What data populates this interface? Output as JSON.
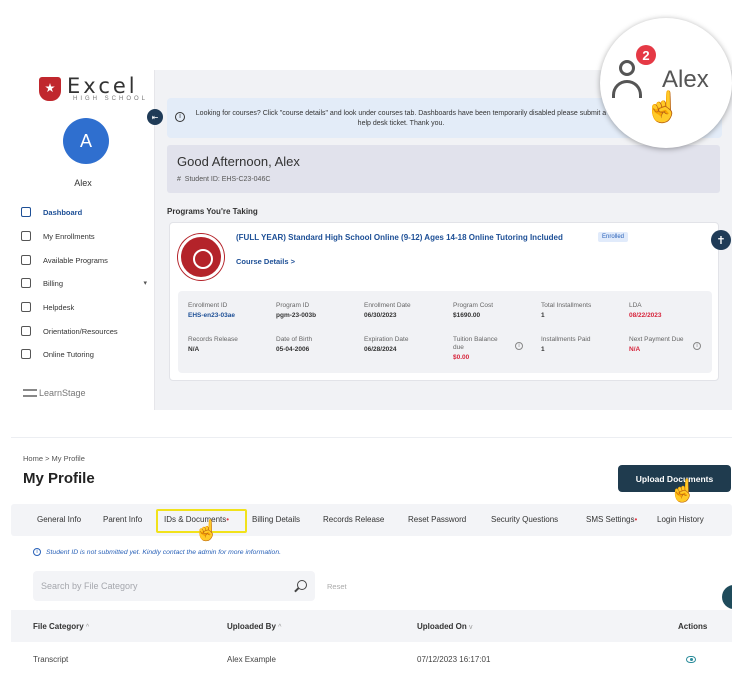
{
  "brand": {
    "name": "Excel",
    "subtitle": "HIGH SCHOOL",
    "footer": "LearnStage"
  },
  "user": {
    "initial": "A",
    "name": "Alex",
    "notifications": "2"
  },
  "sidebar": {
    "items": [
      {
        "label": "Dashboard",
        "icon": "home-icon",
        "active": true
      },
      {
        "label": "My Enrollments",
        "icon": "book-icon"
      },
      {
        "label": "Available Programs",
        "icon": "grid-icon"
      },
      {
        "label": "Billing",
        "icon": "card-icon",
        "caret": "▾"
      },
      {
        "label": "Helpdesk",
        "icon": "headset-icon"
      },
      {
        "label": "Orientation/Resources",
        "icon": "building-icon"
      },
      {
        "label": "Online Tutoring",
        "icon": "monitor-icon"
      }
    ]
  },
  "notice": {
    "text": "Looking for courses? Click \"course details\" and look under courses tab. Dashboards have been temporarily disabled please submit a help desk ticket. Thank you."
  },
  "greeting": {
    "title": "Good Afternoon, Alex",
    "student_id": "Student ID: EHS-C23-046C"
  },
  "programs": {
    "heading": "Programs You're Taking",
    "title": "(FULL YEAR) Standard High School Online (9-12) Ages 14-18 Online Tutoring Included",
    "status": "Enrolled",
    "course_link": "Course Details >",
    "details": {
      "enrollment_id_label": "Enrollment ID",
      "enrollment_id": "EHS-en23-03ae",
      "program_id_label": "Program ID",
      "program_id": "pgm-23-003b",
      "enrollment_date_label": "Enrollment Date",
      "enrollment_date": "06/30/2023",
      "program_cost_label": "Program Cost",
      "program_cost": "$1690.00",
      "total_installments_label": "Total Installments",
      "total_installments": "1",
      "lda_label": "LDA",
      "lda": "08/22/2023",
      "records_release_label": "Records Release",
      "records_release": "N/A",
      "dob_label": "Date of Birth",
      "dob": "05-04-2006",
      "expiration_label": "Expiration Date",
      "expiration": "06/28/2024",
      "tuition_due_label": "Tuition Balance due",
      "tuition_due": "$0.00",
      "installments_paid_label": "Installments Paid",
      "installments_paid": "1",
      "next_payment_label": "Next Payment Due",
      "next_payment": "N/A"
    }
  },
  "profile": {
    "breadcrumb": "Home  >  My Profile",
    "title": "My Profile",
    "upload_button": "Upload Documents",
    "tabs": [
      {
        "label": "General Info"
      },
      {
        "label": "Parent Info"
      },
      {
        "label": "IDs & Documents",
        "dot": "•"
      },
      {
        "label": "Billing Details"
      },
      {
        "label": "Records Release"
      },
      {
        "label": "Reset Password"
      },
      {
        "label": "Security Questions"
      },
      {
        "label": "SMS Settings",
        "dot": "•"
      },
      {
        "label": "Login History"
      }
    ],
    "alert": "Student ID is not submitted yet. Kindly contact the admin for more information.",
    "search_placeholder": "Search by File Category",
    "reset_label": "Reset",
    "columns": [
      {
        "label": "File Category",
        "sort": "^"
      },
      {
        "label": "Uploaded By",
        "sort": "^"
      },
      {
        "label": "Uploaded On",
        "sort": "v"
      },
      {
        "label": "Actions"
      }
    ],
    "rows": [
      {
        "category": "Transcript",
        "uploaded_by": "Alex Example",
        "uploaded_on": "07/12/2023 16:17:01"
      }
    ]
  },
  "colors": {
    "primary": "#1d4f96",
    "dark_button": "#1f3b4e",
    "alert_red": "#d7263d",
    "highlight": "#f1e21b"
  }
}
